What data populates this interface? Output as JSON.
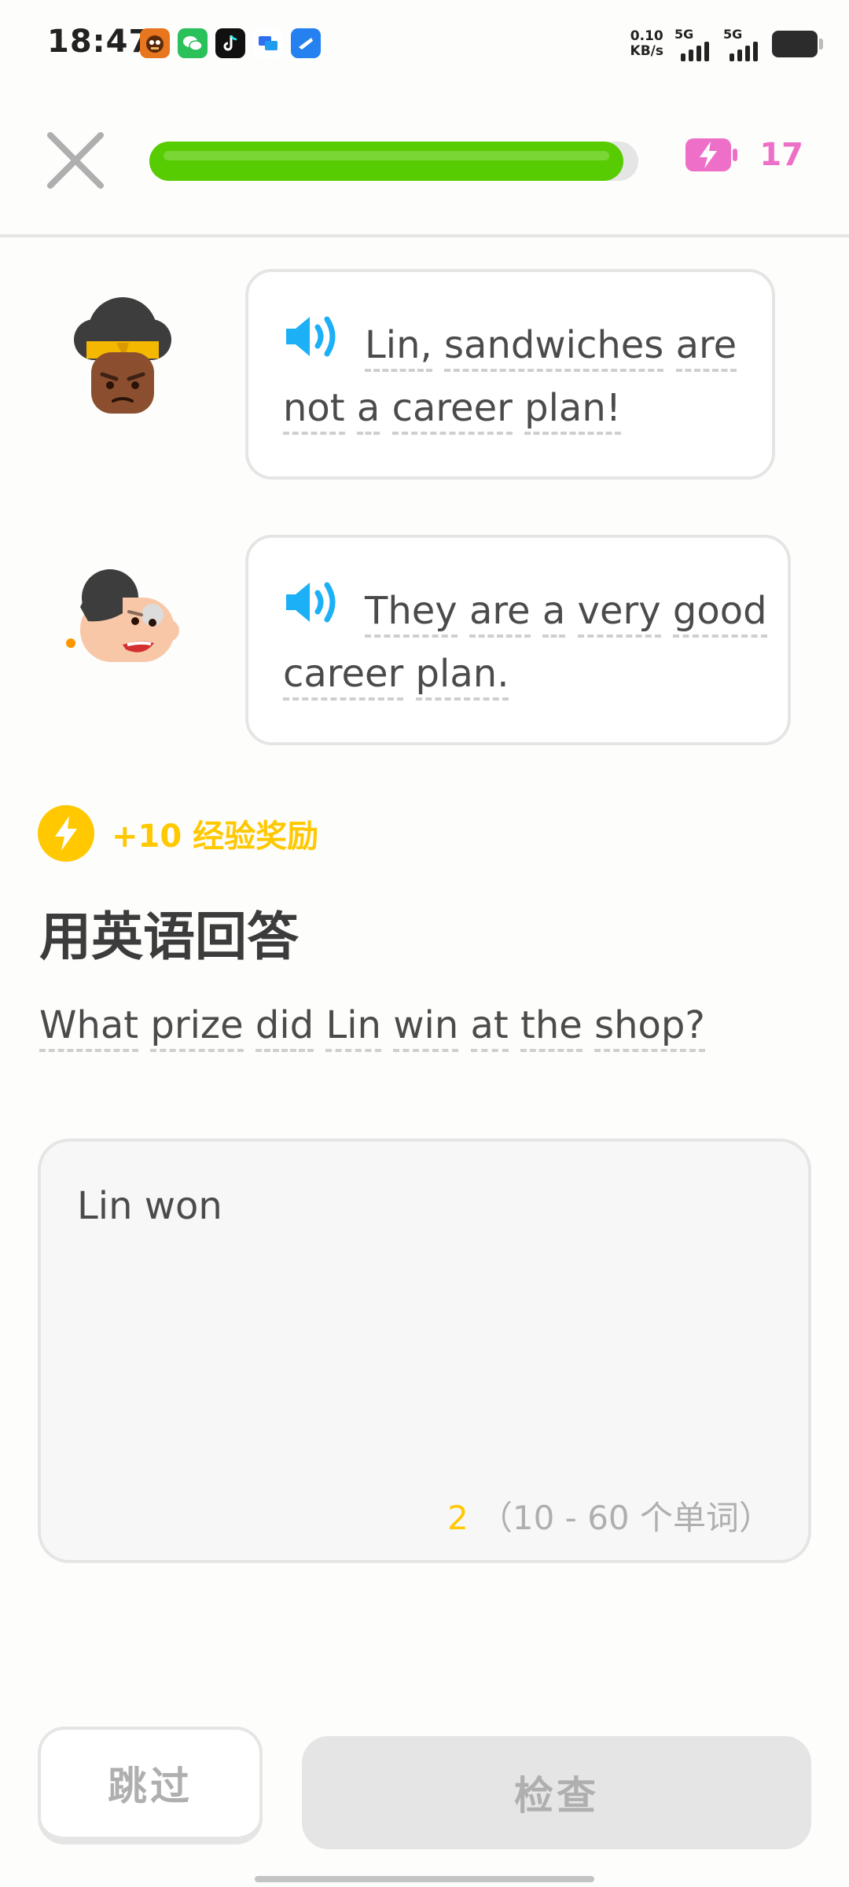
{
  "status_bar": {
    "time": "18:47",
    "net_speed_value": "0.10",
    "net_speed_unit": "KB/s",
    "sim1": "5G",
    "sim2": "5G",
    "app_icons": [
      "tiger-app-icon",
      "wechat-icon",
      "tiktok-icon",
      "message-app-icon",
      "blue-app-icon"
    ]
  },
  "lesson": {
    "progress": 0.97,
    "energy_count": "17",
    "colors": {
      "progress": "#58cc02",
      "energy": "#ee6fc7",
      "xp": "#ffc800",
      "speaker": "#1cb0f6"
    }
  },
  "dialogue": [
    {
      "speaker": "bea-character",
      "line1_words": [
        "Lin,",
        "sandwiches",
        "are"
      ],
      "line2_words": [
        "not",
        "a",
        "career",
        "plan!"
      ]
    },
    {
      "speaker": "grandma-character",
      "line1_words": [
        "They",
        "are",
        "a",
        "very",
        "good"
      ],
      "line2_words": [
        "career",
        "plan."
      ]
    }
  ],
  "challenge": {
    "xp_reward": "+10 经验奖励",
    "title": "用英语回答",
    "question_words": [
      "What",
      "prize",
      "did",
      "Lin",
      "win",
      "at",
      "the",
      "shop?"
    ]
  },
  "answer": {
    "value": "Lin won",
    "word_count": "2",
    "range_hint": "（10 - 60 个单词）"
  },
  "footer": {
    "skip_label": "跳过",
    "check_label": "检查"
  }
}
